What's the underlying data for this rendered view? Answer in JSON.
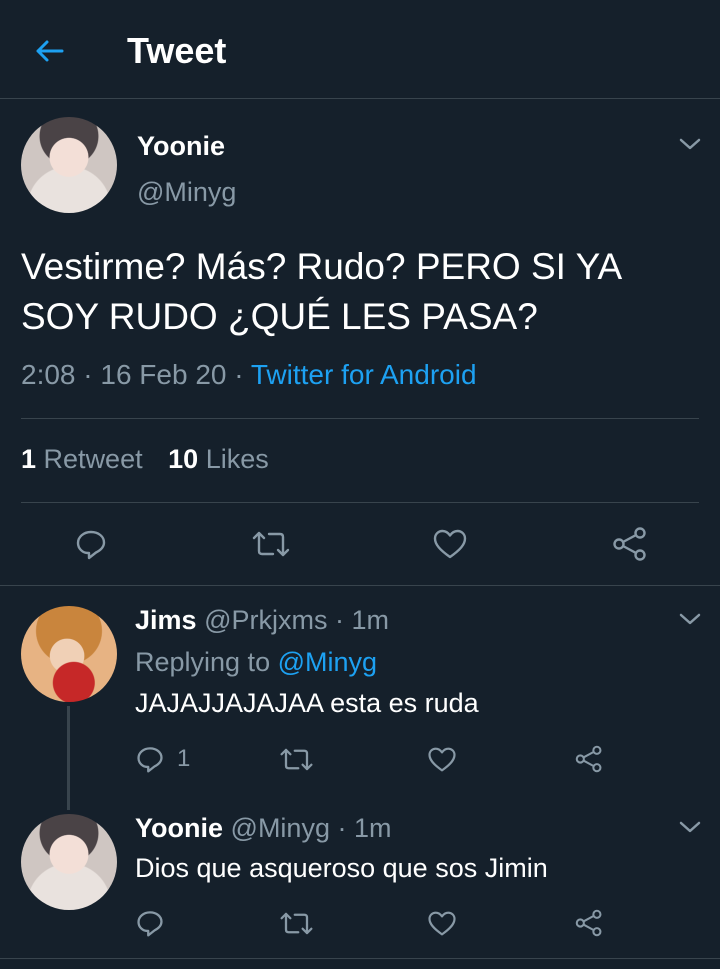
{
  "header": {
    "title": "Tweet"
  },
  "main_tweet": {
    "name": "Yoonie",
    "handle": "@Minyg",
    "text_line1": "Vestirme? Más? Rudo? PERO SI YA",
    "text_line2": "SOY RUDO ¿QUÉ LES PASA?",
    "time": "2:08 · 16 Feb 20 · ",
    "source": "Twitter for Android",
    "retweets_count": "1",
    "retweets_label": "Retweet",
    "likes_count": "10",
    "likes_label": "Likes"
  },
  "replies": [
    {
      "name": "Jims",
      "meta": "@Prkjxms · 1m",
      "replying_prefix": "Replying to ",
      "replying_handle": "@Minyg",
      "text": "JAJAJJAJAJAA esta es ruda",
      "reply_count": "1"
    },
    {
      "name": "Yoonie",
      "meta": "@Minyg · 1m",
      "text": "Dios que asqueroso que sos Jimin"
    }
  ],
  "icons": {
    "back": "arrow-left-icon",
    "reply": "reply-icon",
    "retweet": "retweet-icon",
    "like": "heart-icon",
    "share": "share-icon",
    "more": "chevron-down-icon"
  },
  "colors": {
    "background": "#15202b",
    "divider": "#38444d",
    "muted": "#8899a6",
    "accent": "#1da1f2"
  }
}
